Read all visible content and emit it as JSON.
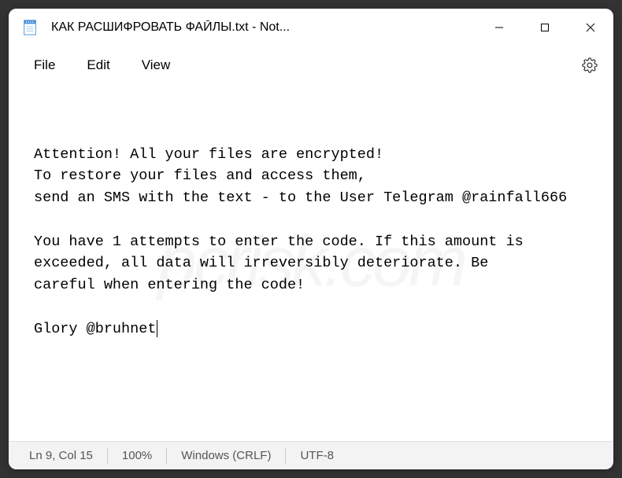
{
  "titlebar": {
    "title": "КАК РАСШИФРОВАТЬ ФАЙЛЫ.txt - Not..."
  },
  "menubar": {
    "file": "File",
    "edit": "Edit",
    "view": "View"
  },
  "content": {
    "line1": "Attention! All your files are encrypted!",
    "line2": "To restore your files and access them,",
    "line3": "send an SMS with the text - to the User Telegram @rainfall666",
    "line4": "",
    "line5": "You have 1 attempts to enter the code. If this amount is exceeded, all data will irreversibly deteriorate. Be",
    "line6": "careful when entering the code!",
    "line7": "",
    "line8": "Glory @bruhnet"
  },
  "statusbar": {
    "position": "Ln 9, Col 15",
    "zoom": "100%",
    "lineending": "Windows (CRLF)",
    "encoding": "UTF-8"
  }
}
